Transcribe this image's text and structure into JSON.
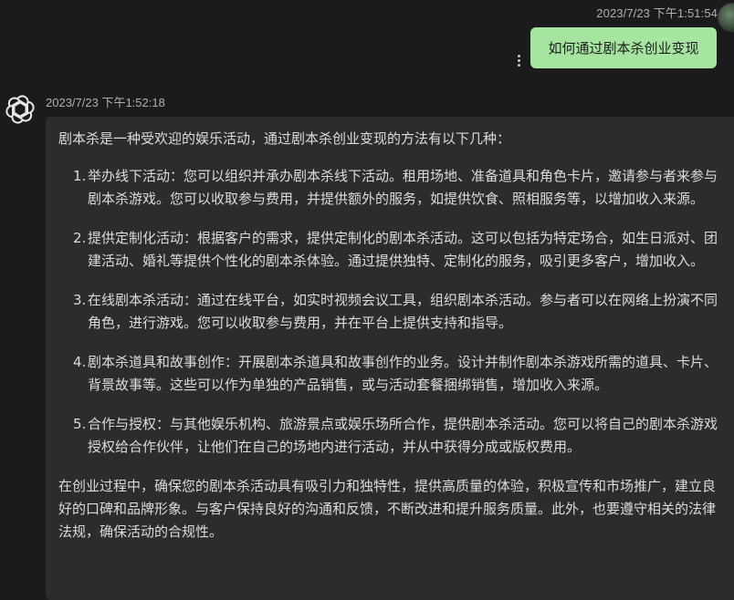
{
  "user_message": {
    "timestamp": "2023/7/23 下午1:51:54",
    "text": "如何通过剧本杀创业变现"
  },
  "assistant_message": {
    "timestamp": "2023/7/23 下午1:52:18",
    "intro": "剧本杀是一种受欢迎的娱乐活动，通过剧本杀创业变现的方法有以下几种：",
    "points": [
      {
        "num": "1.",
        "text": "举办线下活动：您可以组织并承办剧本杀线下活动。租用场地、准备道具和角色卡片，邀请参与者来参与剧本杀游戏。您可以收取参与费用，并提供额外的服务，如提供饮食、照相服务等，以增加收入来源。"
      },
      {
        "num": "2.",
        "text": "提供定制化活动：根据客户的需求，提供定制化的剧本杀活动。这可以包括为特定场合，如生日派对、团建活动、婚礼等提供个性化的剧本杀体验。通过提供独特、定制化的服务，吸引更多客户，增加收入。"
      },
      {
        "num": "3.",
        "text": "在线剧本杀活动：通过在线平台，如实时视频会议工具，组织剧本杀活动。参与者可以在网络上扮演不同角色，进行游戏。您可以收取参与费用，并在平台上提供支持和指导。"
      },
      {
        "num": "4.",
        "text": "剧本杀道具和故事创作：开展剧本杀道具和故事创作的业务。设计并制作剧本杀游戏所需的道具、卡片、背景故事等。这些可以作为单独的产品销售，或与活动套餐捆绑销售，增加收入来源。"
      },
      {
        "num": "5.",
        "text": "合作与授权：与其他娱乐机构、旅游景点或娱乐场所合作，提供剧本杀活动。您可以将自己的剧本杀游戏授权给合作伙伴，让他们在自己的场地内进行活动，并从中获得分成或版权费用。"
      }
    ],
    "outro": "在创业过程中，确保您的剧本杀活动具有吸引力和独特性，提供高质量的体验，积极宣传和市场推广，建立良好的口碑和品牌形象。与客户保持良好的沟通和反馈，不断改进和提升服务质量。此外，也要遵守相关的法律法规，确保活动的合规性。"
  },
  "icons": {
    "more": "more-vertical-icon",
    "bot_avatar": "openai-logo-icon",
    "user_avatar": "user-avatar"
  },
  "colors": {
    "background": "#1b1b1d",
    "user_bubble": "#a5e5a0",
    "assistant_bubble": "#2c2c2f"
  }
}
